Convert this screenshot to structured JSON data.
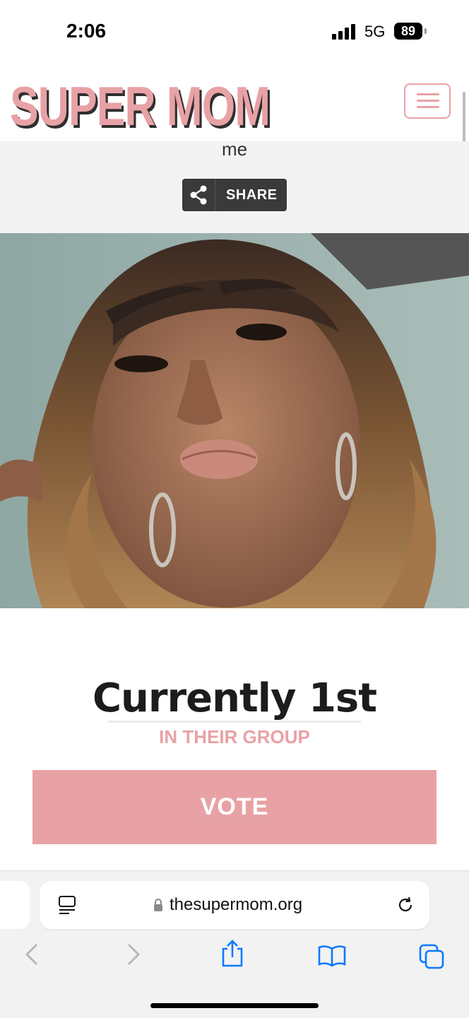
{
  "status_bar": {
    "time": "2:06",
    "network": "5G",
    "battery": "89"
  },
  "header": {
    "logo": "SUPER MOM"
  },
  "profile": {
    "name_fragment": "me",
    "share_label": "SHARE",
    "rank_text": "Currently 1st",
    "rank_sub": "IN THEIR GROUP",
    "vote_label": "VOTE"
  },
  "browser": {
    "url": "thesupermom.org"
  },
  "colors": {
    "accent": "#e8a2a6",
    "dark": "#3a3a3a",
    "ios_blue": "#0a7aff"
  }
}
